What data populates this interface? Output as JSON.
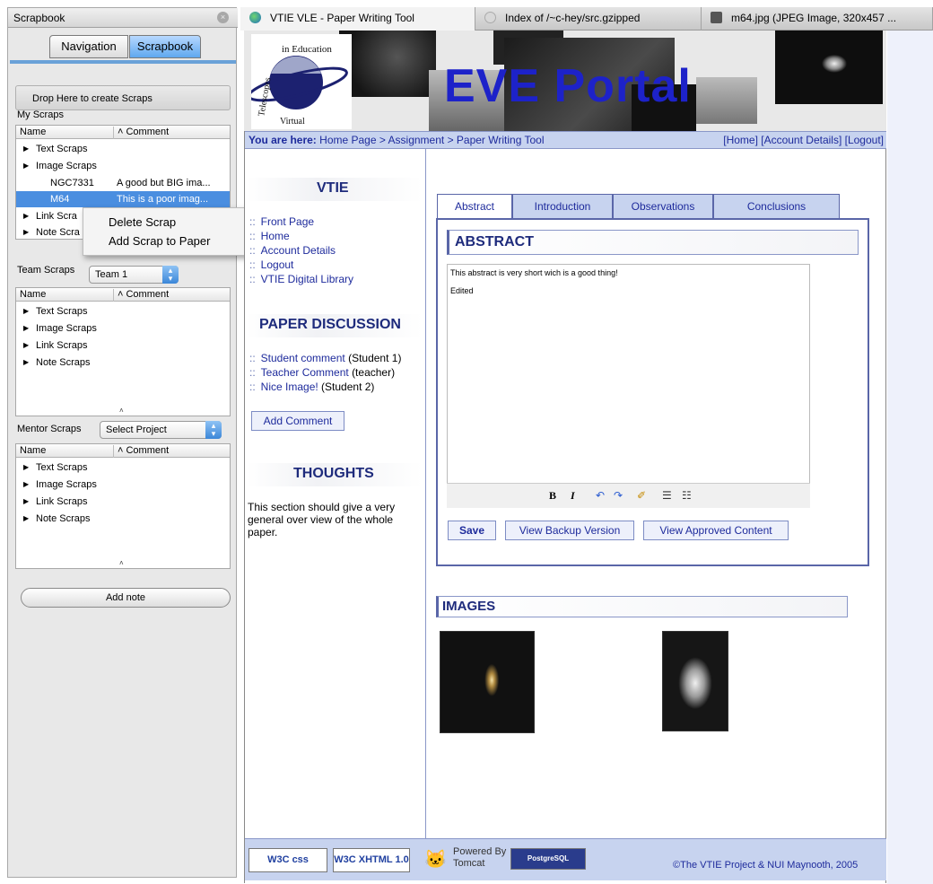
{
  "scrapbook": {
    "title": "Scrapbook",
    "tabs": [
      "Navigation",
      "Scrapbook"
    ],
    "drop_label": "Drop Here to create Scraps",
    "my_scraps": {
      "label": "My Scraps",
      "col_name": "Name",
      "col_comment": "Comment",
      "rows": [
        {
          "name": "Text Scraps"
        },
        {
          "name": "Image Scraps"
        },
        {
          "name": "NGC7331",
          "comment": "A good but BIG ima..."
        },
        {
          "name": "M64",
          "comment": "This is a poor imag..."
        },
        {
          "name": "Link Scra"
        },
        {
          "name": "Note Scra"
        }
      ]
    },
    "context_menu": [
      "Delete Scrap",
      "Add Scrap to Paper"
    ],
    "team_scraps": {
      "label": "Team Scraps",
      "select": "Team 1",
      "col_name": "Name",
      "col_comment": "Comment",
      "rows": [
        "Text Scraps",
        "Image Scraps",
        "Link Scraps",
        "Note Scraps"
      ]
    },
    "mentor_scraps": {
      "label": "Mentor Scraps",
      "select": "Select Project",
      "col_name": "Name",
      "col_comment": "Comment",
      "rows": [
        "Text Scraps",
        "Image Scraps",
        "Link Scraps",
        "Note Scraps"
      ]
    },
    "add_note": "Add note"
  },
  "browser_tabs": [
    {
      "title": "VTIE VLE - Paper Writing Tool",
      "active": true
    },
    {
      "title": "Index of /~c-hey/src.gzipped",
      "active": false
    },
    {
      "title": "m64.jpg (JPEG Image, 320x457 ...",
      "active": false
    }
  ],
  "banner": {
    "title": "EVE Portal",
    "logo_text_top": "in Education",
    "logo_text_left": "Telescopes",
    "logo_text_bottom": "Virtual"
  },
  "navbar": {
    "you_are_here": "You are here:",
    "crumbs": "Home Page > Assignment > Paper Writing Tool",
    "links": "[Home] [Account Details] [Logout]"
  },
  "sidebar": {
    "vtie_title": "VTIE",
    "vtie_links": [
      "Front Page",
      "Home",
      "Account Details",
      "Logout",
      "VTIE Digital Library"
    ],
    "discussion_title": "PAPER DISCUSSION",
    "discussion": [
      {
        "link": "Student comment",
        "who": "(Student 1)"
      },
      {
        "link": "Teacher Comment",
        "who": "(teacher)"
      },
      {
        "link": "Nice Image!",
        "who": "(Student 2)"
      }
    ],
    "add_comment": "Add Comment",
    "thoughts_title": "THOUGHTS",
    "thoughts_text": [
      "This section should give a very",
      "general over view of the whole",
      "paper."
    ]
  },
  "editor": {
    "tabs": [
      "Abstract",
      "Introduction",
      "Observations",
      "Conclusions"
    ],
    "heading": "ABSTRACT",
    "text_line1": "This abstract is very short wich is a good thing!",
    "text_line2": "Edited",
    "toolbar": [
      "B",
      "I",
      "↶",
      "↷",
      "✐",
      "☰",
      "☷"
    ],
    "save": "Save",
    "backup": "View Backup Version",
    "approved": "View Approved Content"
  },
  "images": {
    "heading": "IMAGES"
  },
  "footer": {
    "badge1": "W3C css",
    "badge2": "W3C XHTML 1.0",
    "powered_line1": "Powered By",
    "powered_line2": "Tomcat",
    "pg": "PostgreSQL",
    "copyright": "©The VTIE Project & NUI Maynooth, 2005"
  }
}
